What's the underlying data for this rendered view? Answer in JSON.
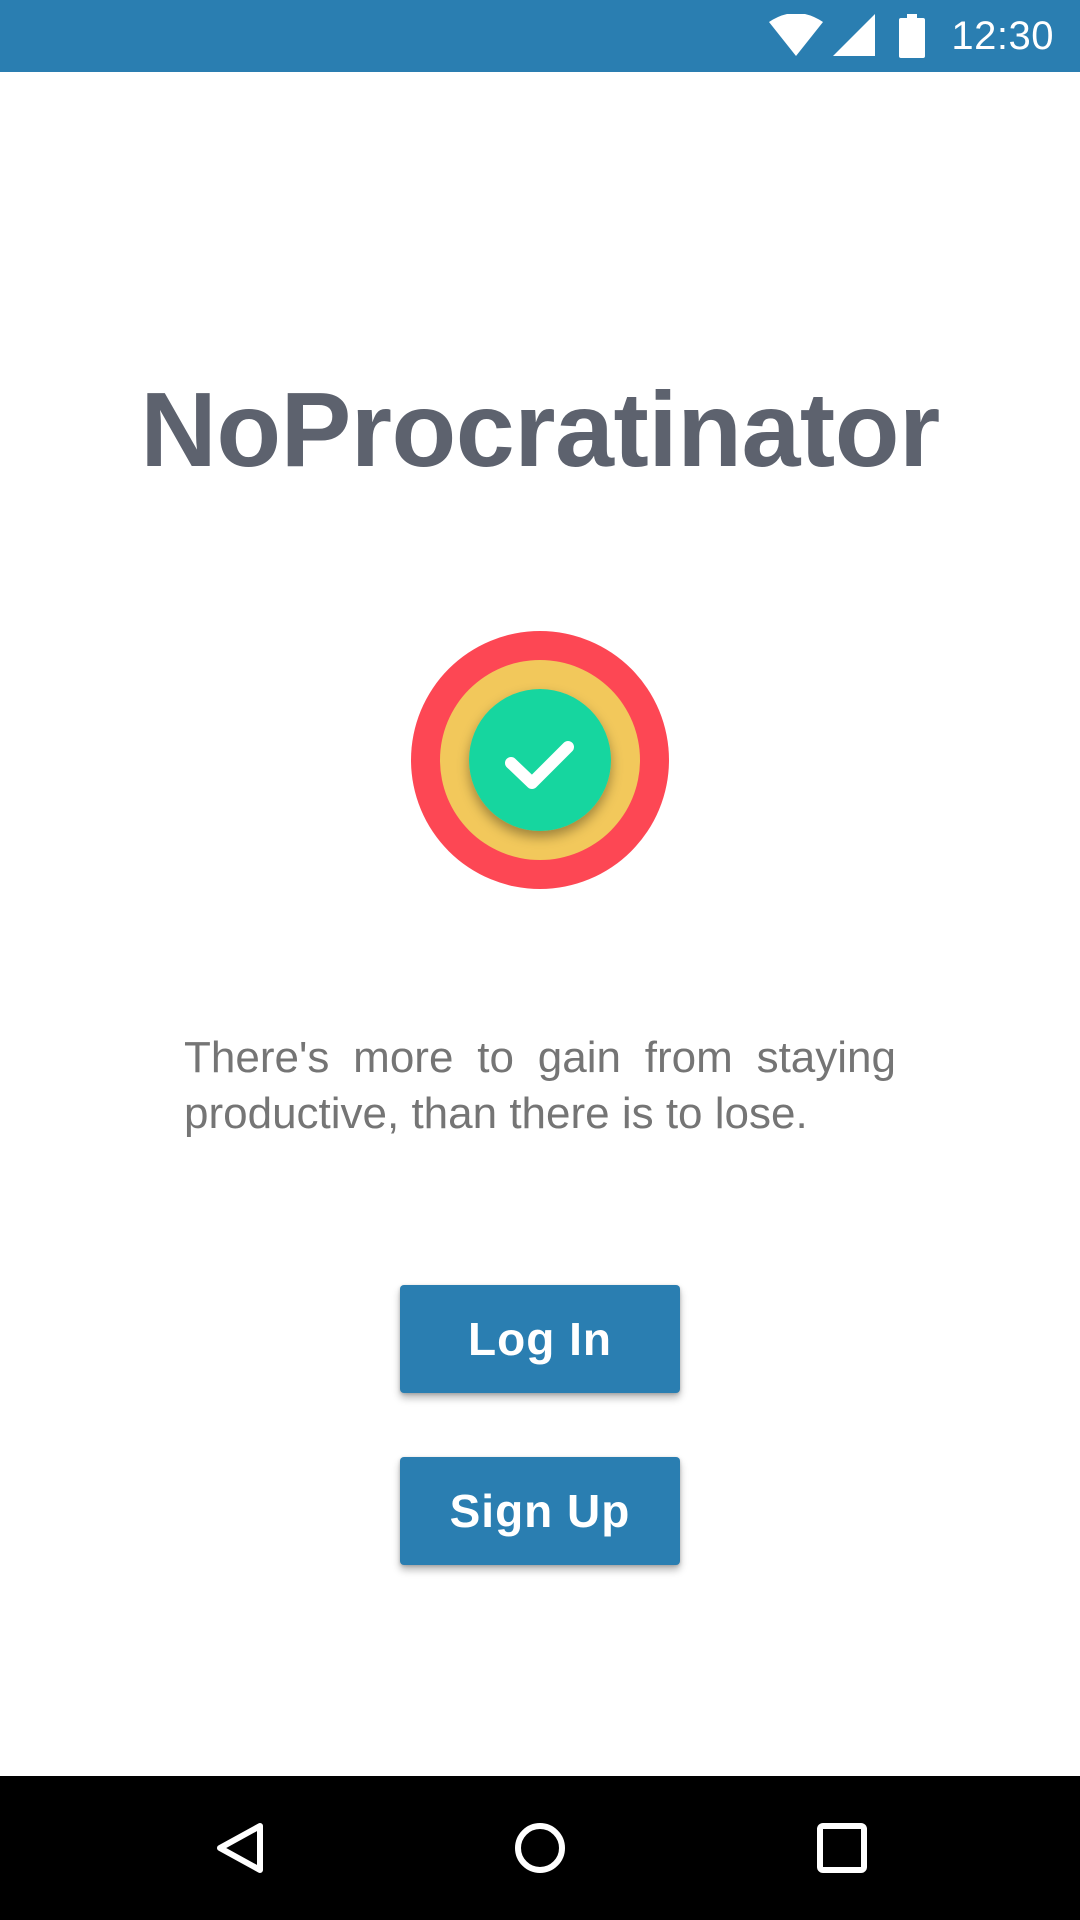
{
  "status_bar": {
    "time": "12:30",
    "background_color": "#2a7eb1",
    "icons": [
      "wifi-icon",
      "cell-signal-icon",
      "battery-icon"
    ]
  },
  "app": {
    "title": "NoProcratinator",
    "logo": {
      "icon": "checkmark-target-logo",
      "colors": {
        "outer_ring": "#fd4754",
        "middle_ring": "#f2c85b",
        "inner_circle": "#17d69f",
        "check": "#ffffff"
      }
    },
    "tagline": "There's more to gain from staying productive, than there is to lose."
  },
  "actions": {
    "login_label": "Log In",
    "signup_label": "Sign Up",
    "button_color": "#2a7eb1"
  },
  "nav_bar": {
    "icons": [
      "back-icon",
      "home-icon",
      "recents-icon"
    ]
  }
}
